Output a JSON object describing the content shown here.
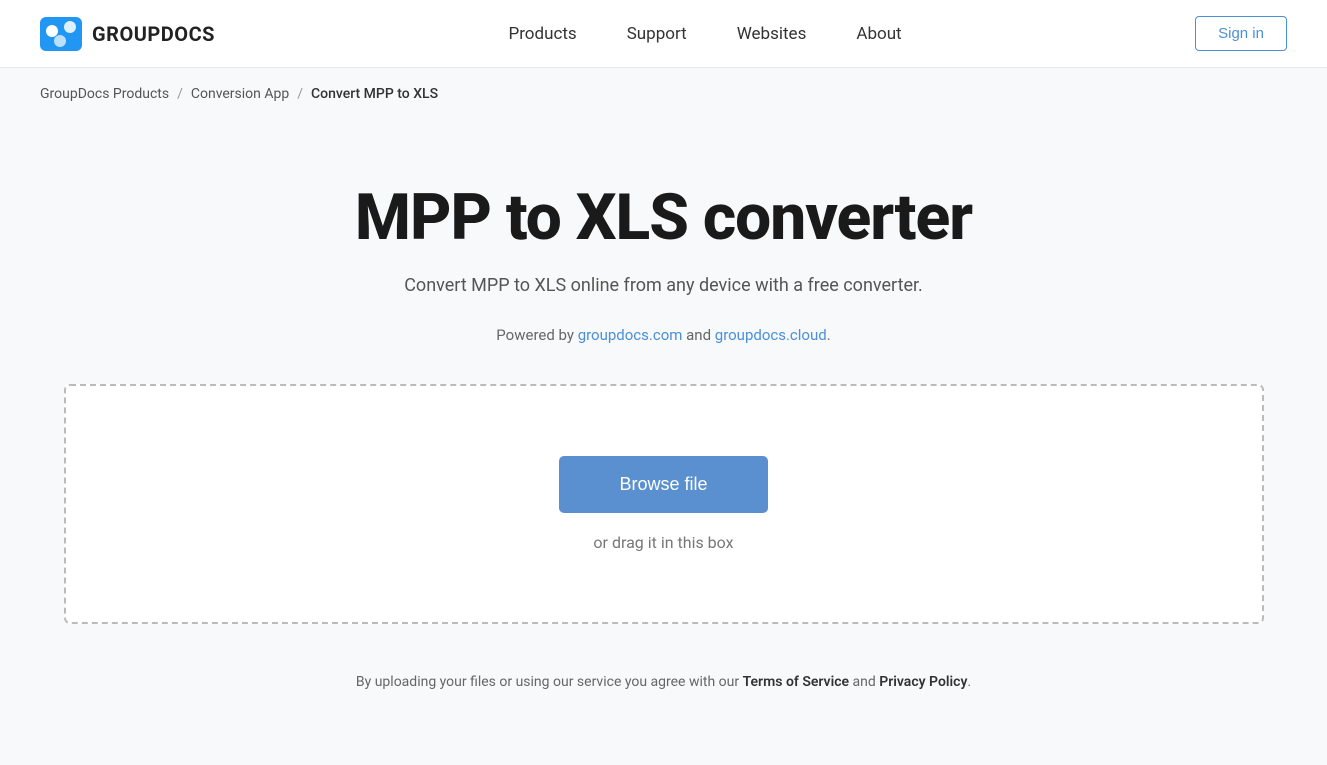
{
  "header": {
    "logo_text": "GROUPDOCS",
    "nav_items": [
      "Products",
      "Support",
      "Websites",
      "About"
    ],
    "signin_label": "Sign in"
  },
  "breadcrumb": {
    "items": [
      "GroupDocs Products",
      "Conversion App",
      "Convert MPP to XLS"
    ],
    "separators": [
      "/",
      "/"
    ]
  },
  "main": {
    "title": "MPP to XLS converter",
    "subtitle": "Convert MPP to XLS online from any device with a free converter.",
    "powered_by_prefix": "Powered by ",
    "powered_by_link1": "groupdocs.com",
    "powered_by_and": " and ",
    "powered_by_link2": "groupdocs.cloud",
    "powered_by_suffix": "."
  },
  "dropzone": {
    "browse_label": "Browse file",
    "drag_hint": "or drag it in this box"
  },
  "footer_note": {
    "prefix": "By uploading your files or using our service you agree with our ",
    "terms_label": "Terms of Service",
    "and": " and ",
    "privacy_label": "Privacy Policy",
    "suffix": "."
  }
}
